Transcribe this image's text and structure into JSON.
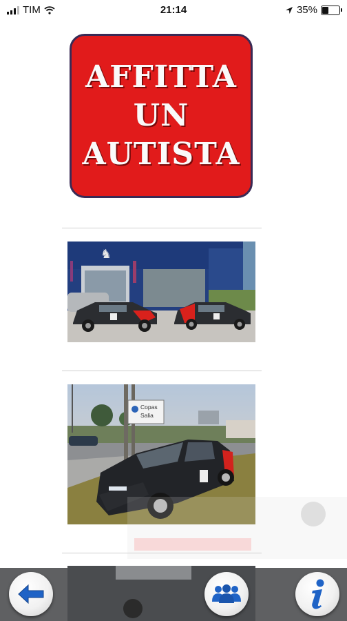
{
  "status_bar": {
    "carrier": "TIM",
    "time": "21:14",
    "battery_percent": "35%",
    "battery_level": 0.35,
    "icons": [
      "signal-bars-icon",
      "wifi-icon",
      "location-arrow-icon",
      "battery-icon"
    ]
  },
  "logo": {
    "lines": [
      "AFFITTA",
      "UN",
      "AUTISTA"
    ],
    "colors": {
      "background": "#e11b1b",
      "text": "#fafafa",
      "border": "#3a2a55"
    }
  },
  "photos": {
    "dealership_sign_glyph": "peugeot-lion-logo",
    "street_sign_text": [
      "Copas",
      "Salia"
    ]
  },
  "bottom_bar": {
    "buttons": [
      {
        "name": "back",
        "icon": "arrow-left-icon"
      },
      {
        "name": "people",
        "icon": "people-group-icon"
      },
      {
        "name": "info",
        "icon": "info-icon"
      }
    ],
    "colors": {
      "bar": "#5f6062",
      "icon_blue": "#1f63c6"
    }
  }
}
